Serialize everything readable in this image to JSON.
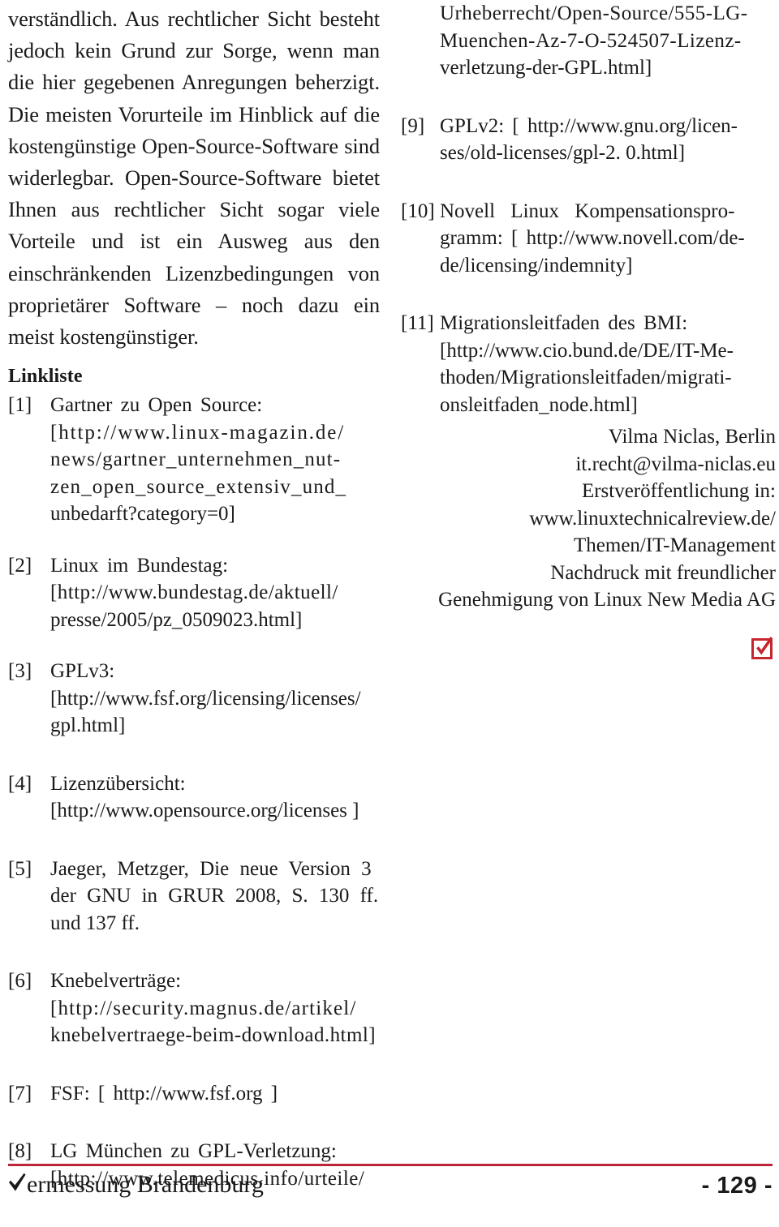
{
  "document": {
    "body_paragraph": "verständlich. Aus rechtlicher Sicht besteht jedoch kein Grund zur Sorge, wenn man die hier gegebenen Anregungen beherzigt. Die meisten Vorurteile im Hinblick auf die kostengünstige Open-Source-Software sind widerlegbar. Open-Source-Software bietet Ihnen aus rechtlicher Sicht sogar viele Vorteile und ist ein Ausweg aus den einschränkenden Lizenzbedingungen von proprietärer Software – noch dazu ein meist kostengünstiger.",
    "section_heading": "Linkliste"
  },
  "left_column": {
    "references": [
      {
        "tag": "[1]",
        "lines": [
          "Gartner zu Open Source:",
          "[http://www.linux-magazin.de/",
          "news/gartner_unternehmen_nut-",
          "zen_open_source_extensiv_und_",
          "unbedarft?category=0]"
        ]
      },
      {
        "tag": "[2]",
        "lines": [
          "Linux im Bundestag:",
          "[http://www.bundestag.de/aktuell/",
          "presse/2005/pz_0509023.html]"
        ]
      },
      {
        "tag": "[3]",
        "lines": [
          "GPLv3:",
          "[http://www.fsf.org/licensing/licenses/",
          "gpl.html]"
        ]
      },
      {
        "tag": "[4]",
        "lines": [
          "Lizenzübersicht:",
          "[http://www.opensource.org/licenses ]"
        ]
      },
      {
        "tag": "[5]",
        "lines": [
          "Jaeger, Metzger, Die neue Version 3",
          "der GNU in GRUR 2008, S. 130 ff.",
          "und 137 ff."
        ]
      },
      {
        "tag": "[6]",
        "lines": [
          "Knebelverträge:",
          "[http://security.magnus.de/artikel/",
          "knebelvertraege-beim-download.html]"
        ]
      },
      {
        "tag": "[7]",
        "lines": [
          "FSF: [ http://www.fsf.org ]"
        ]
      },
      {
        "tag": "[8]",
        "lines": [
          "LG München zu GPL-Verletzung:",
          "[http://www.telemedicus.info/urteile/"
        ]
      }
    ]
  },
  "right_column": {
    "continuation_lines": [
      "Urheberrecht/Open-Source/555-LG-",
      "Muenchen-Az-7-O-524507-Lizenz-",
      "verletzung-der-GPL.html]"
    ],
    "references": [
      {
        "tag": "[9]",
        "lines": [
          "GPLv2: [ http://www.gnu.org/licen-",
          "ses/old-licenses/gpl-2. 0.html]"
        ]
      },
      {
        "tag": "[10]",
        "lines": [
          "Novell Linux Kompensationspro-",
          "gramm: [ http://www.novell.com/de-",
          "de/licensing/indemnity]"
        ]
      },
      {
        "tag": "[11]",
        "lines": [
          "Migrationsleitfaden des BMI:",
          "[http://www.cio.bund.de/DE/IT-Me-",
          "thoden/Migrationsleitfaden/migrati-",
          "onsleitfaden_node.html]"
        ]
      }
    ],
    "colophon": [
      "Vilma Niclas, Berlin",
      "it.recht@vilma-niclas.eu",
      "Erstveröffentlichung in:",
      "www.linuxtechnicalreview.de/",
      "Themen/IT-Management",
      "Nachdruck mit freundlicher",
      "Genehmigung von Linux New Media AG"
    ],
    "end_mark": "checkbox-check-icon"
  },
  "footer": {
    "brand_mark": "check-icon",
    "brand_text": "ermessung Brandenburg",
    "page_number": "- 129 -"
  },
  "colors": {
    "rule_red": "#bf2436",
    "endmark_red": "#c6262e",
    "text": "#1a1a1a",
    "background": "#ffffff"
  }
}
